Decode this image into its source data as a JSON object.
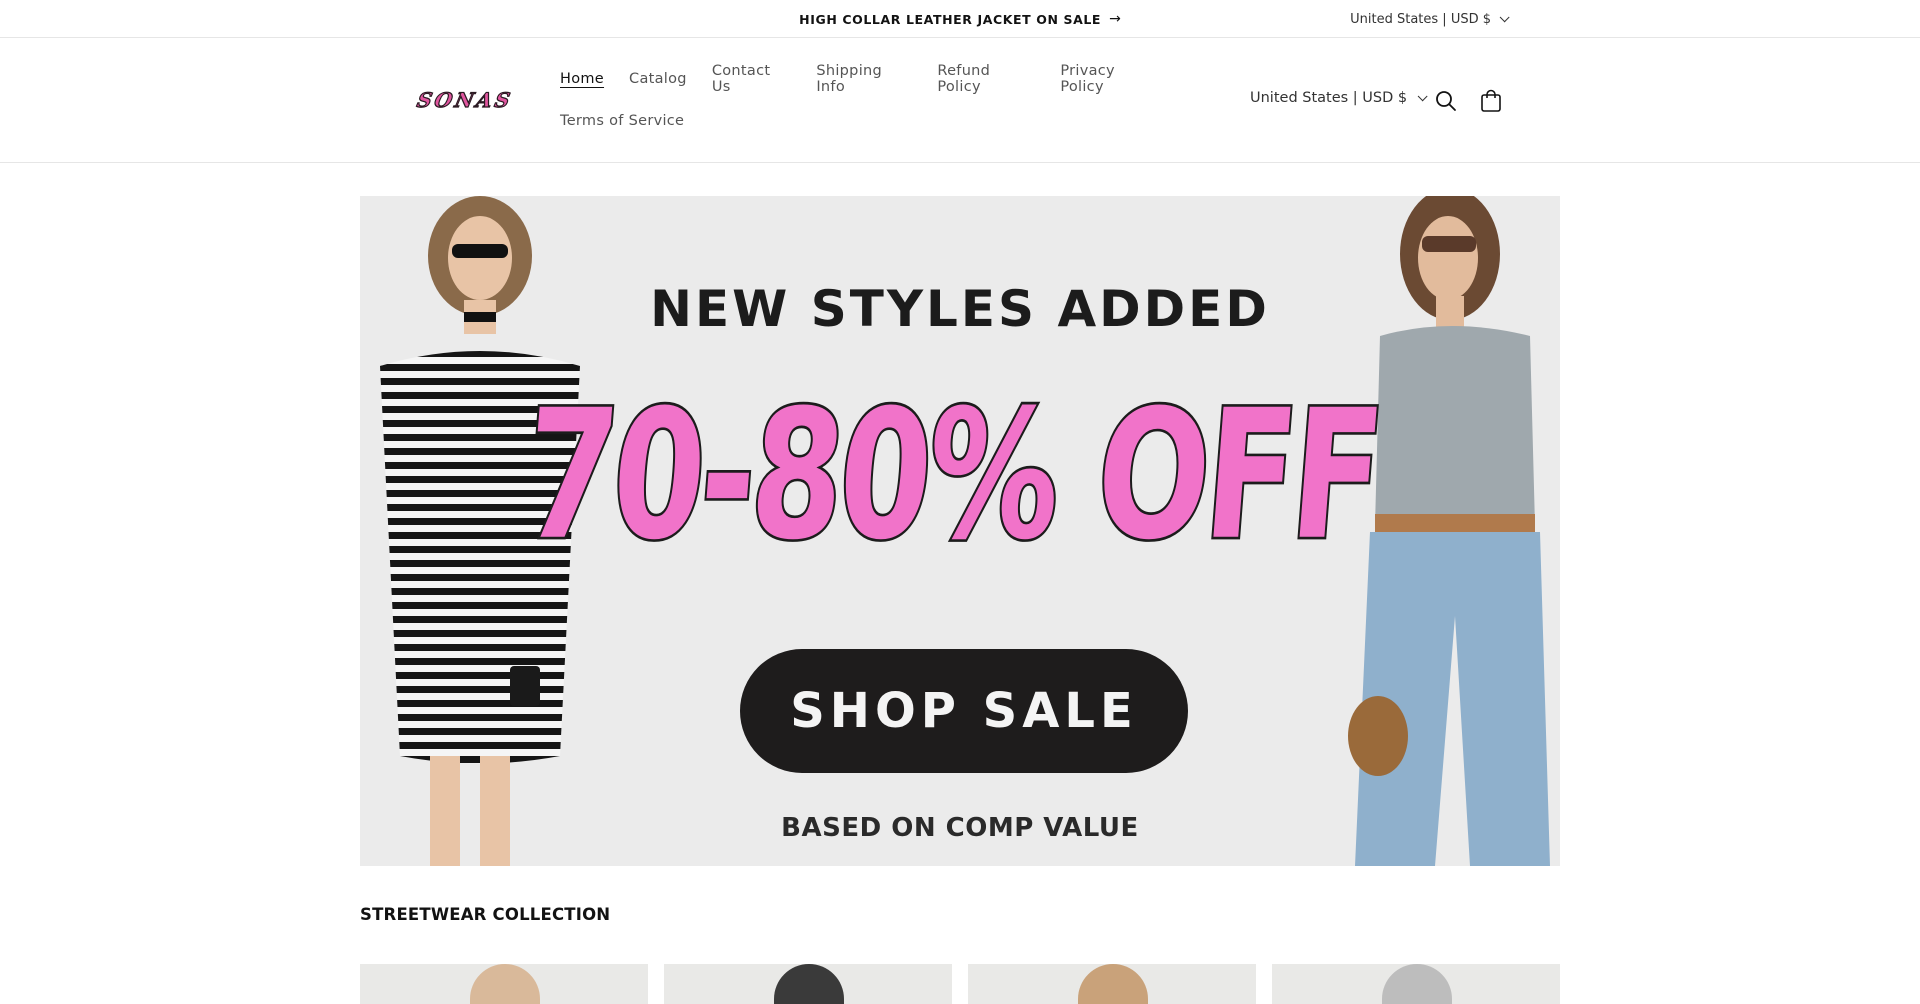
{
  "announcement": {
    "text": "HIGH COLLAR LEATHER JACKET ON SALE",
    "arrow": "→",
    "locale": "United States | USD $"
  },
  "header": {
    "logo_text": "SONAS",
    "nav": [
      {
        "label": "Home",
        "active": true
      },
      {
        "label": "Catalog"
      },
      {
        "label": "Contact Us"
      },
      {
        "label": "Shipping Info"
      },
      {
        "label": "Refund Policy"
      },
      {
        "label": "Privacy Policy"
      },
      {
        "label": "Terms of Service"
      }
    ],
    "locale": "United States | USD $",
    "icons": {
      "search": "search-icon",
      "cart": "cart-icon",
      "chevron": "chevron-down-icon"
    }
  },
  "hero": {
    "headline": "NEW STYLES ADDED",
    "discount": "70-80% OFF",
    "cta": "SHOP SALE",
    "subtext": "BASED ON COMP VALUE",
    "colors": {
      "background": "#ebebeb",
      "discount": "#f173c9",
      "cta_bg": "#1e1c1c"
    }
  },
  "collection": {
    "title": "STREETWEAR COLLECTION"
  },
  "colors": {
    "accent_pink": "#e0569f",
    "text": "#121212",
    "border": "#e6e6e6"
  }
}
